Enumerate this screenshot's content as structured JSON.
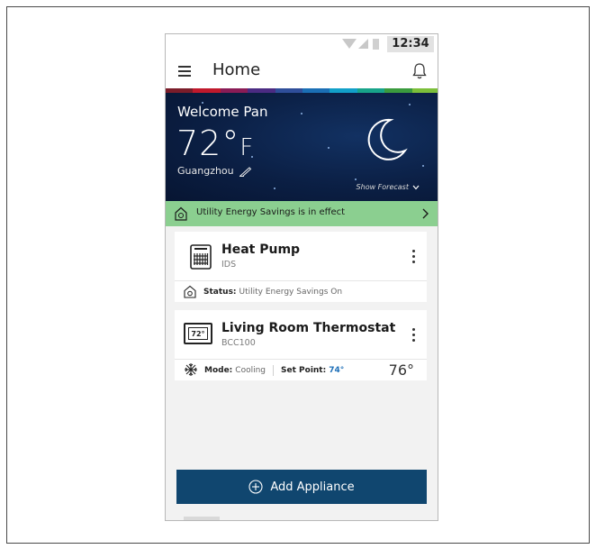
{
  "status_bar": {
    "time": "12:34"
  },
  "app_bar": {
    "title": "Home",
    "menu_icon": "menu-icon",
    "notification_icon": "bell-icon"
  },
  "brand_strip_colors": [
    "#7b1d2a",
    "#c0192c",
    "#8a1c56",
    "#4b2b83",
    "#2f4e9a",
    "#1b6fb5",
    "#12a0c9",
    "#18a48a",
    "#3b9b3e",
    "#7cbf3a"
  ],
  "hero": {
    "welcome": "Welcome Pan",
    "temperature": "72°",
    "unit": "F",
    "city": "Guangzhou",
    "forecast_label": "Show Forecast",
    "weather_icon": "moon-icon"
  },
  "banner": {
    "text": "Utility Energy Savings is in effect",
    "color": "#8bcf90"
  },
  "devices": [
    {
      "name": "Heat Pump",
      "model": "IDS",
      "status_label": "Status:",
      "status_value": "Utility Energy Savings On"
    },
    {
      "name": "Living Room Thermostat",
      "model": "BCC100",
      "display": "72°",
      "mode_label": "Mode:",
      "mode_value": "Cooling",
      "setpoint_label": "Set Point:",
      "setpoint_value": "74°",
      "current_temp": "76°"
    }
  ],
  "add_button": {
    "label": "Add Appliance",
    "color": "#10466f"
  }
}
